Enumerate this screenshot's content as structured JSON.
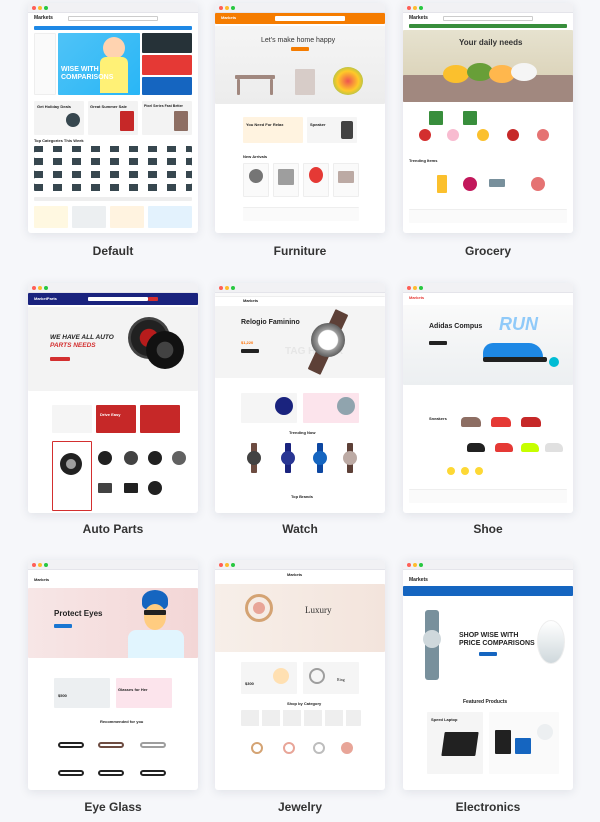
{
  "themes": [
    {
      "name": "Default",
      "brand": "Markets",
      "hero_lines": [
        "WISE WITH",
        "COMPARISONS"
      ],
      "promo_a": "Get Holiday Deals",
      "promo_b": "Great Summer Sale",
      "promo_c": "Pixel Series Fast Better",
      "section": "Top Categories This Week",
      "accent": "#1e88e5"
    },
    {
      "name": "Furniture",
      "brand": "Markets",
      "hero_title": "Let's make home happy",
      "promo_a": "You Need For Relax",
      "promo_b": "Speaker",
      "section": "New Arrivals",
      "accent": "#f57c00"
    },
    {
      "name": "Grocery",
      "brand": "Markets",
      "hero_title": "Your daily needs",
      "section": "Trending Items",
      "accent": "#388e3c"
    },
    {
      "name": "Auto Parts",
      "brand": "MarketParts",
      "hero_lines": [
        "WE HAVE ALL AUTO",
        "PARTS NEEDS"
      ],
      "promo_a": "Drive Easy",
      "accent": "#d32f2f"
    },
    {
      "name": "Watch",
      "brand": "Markets",
      "hero_title": "Relogio Faminino",
      "price": "$1,220",
      "section": "Trending Now",
      "section_b": "Top Brands",
      "watermark": "TAG HEUER",
      "accent": "#ff6f00"
    },
    {
      "name": "Shoe",
      "brand": "Markets",
      "hero_title": "Adidas Compus",
      "section": "Sneakers",
      "accent": "#e53935"
    },
    {
      "name": "Eye Glass",
      "brand": "Markets",
      "hero_title": "Protect Eyes",
      "promo_a": "$500",
      "promo_b": "Glasses for Her",
      "section": "Recommended for you",
      "accent": "#1976d2"
    },
    {
      "name": "Jewelry",
      "brand": "Markets",
      "hero_title": "Luxury",
      "promo_a": "$300",
      "promo_b": "Ring",
      "section": "Shop by Category",
      "accent": "#b08d57"
    },
    {
      "name": "Electronics",
      "brand": "Markets",
      "hero_lines": [
        "SHOP WISE WITH",
        "PRICE COMPARISONS"
      ],
      "section": "Featured Products",
      "promo_a": "Speed Laptop",
      "accent": "#1565c0"
    }
  ]
}
